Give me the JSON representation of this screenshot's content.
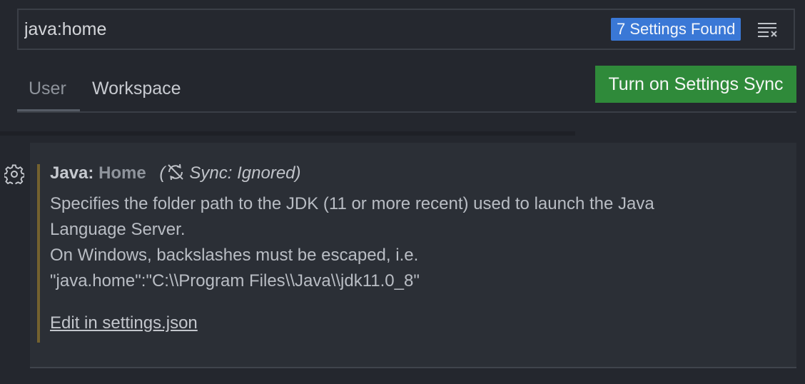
{
  "search": {
    "value": "java:home",
    "results_badge": "7 Settings Found",
    "clear_icon": "clear-filter-icon"
  },
  "tabs": [
    {
      "label": "User",
      "active": true
    },
    {
      "label": "Workspace",
      "active": false
    }
  ],
  "sync_button": {
    "label": "Turn on Settings Sync",
    "color": "#2f8a3a"
  },
  "setting": {
    "category": "Java: ",
    "key": "Home",
    "sync_status": "Sync: Ignored",
    "description_lines": [
      "Specifies the folder path to the JDK (11 or more recent) used to launch the Java",
      "Language Server.",
      "On Windows, backslashes must be escaped, i.e.",
      "\"java.home\":\"C:\\\\Program Files\\\\Java\\\\jdk11.0_8\""
    ],
    "edit_link": "Edit in settings.json",
    "gear_icon": "gear-icon",
    "sync_icon": "sync-ignored-icon"
  },
  "colors": {
    "background": "#24272e",
    "badge": "#3a78d6",
    "modified_indicator": "#74622f"
  }
}
